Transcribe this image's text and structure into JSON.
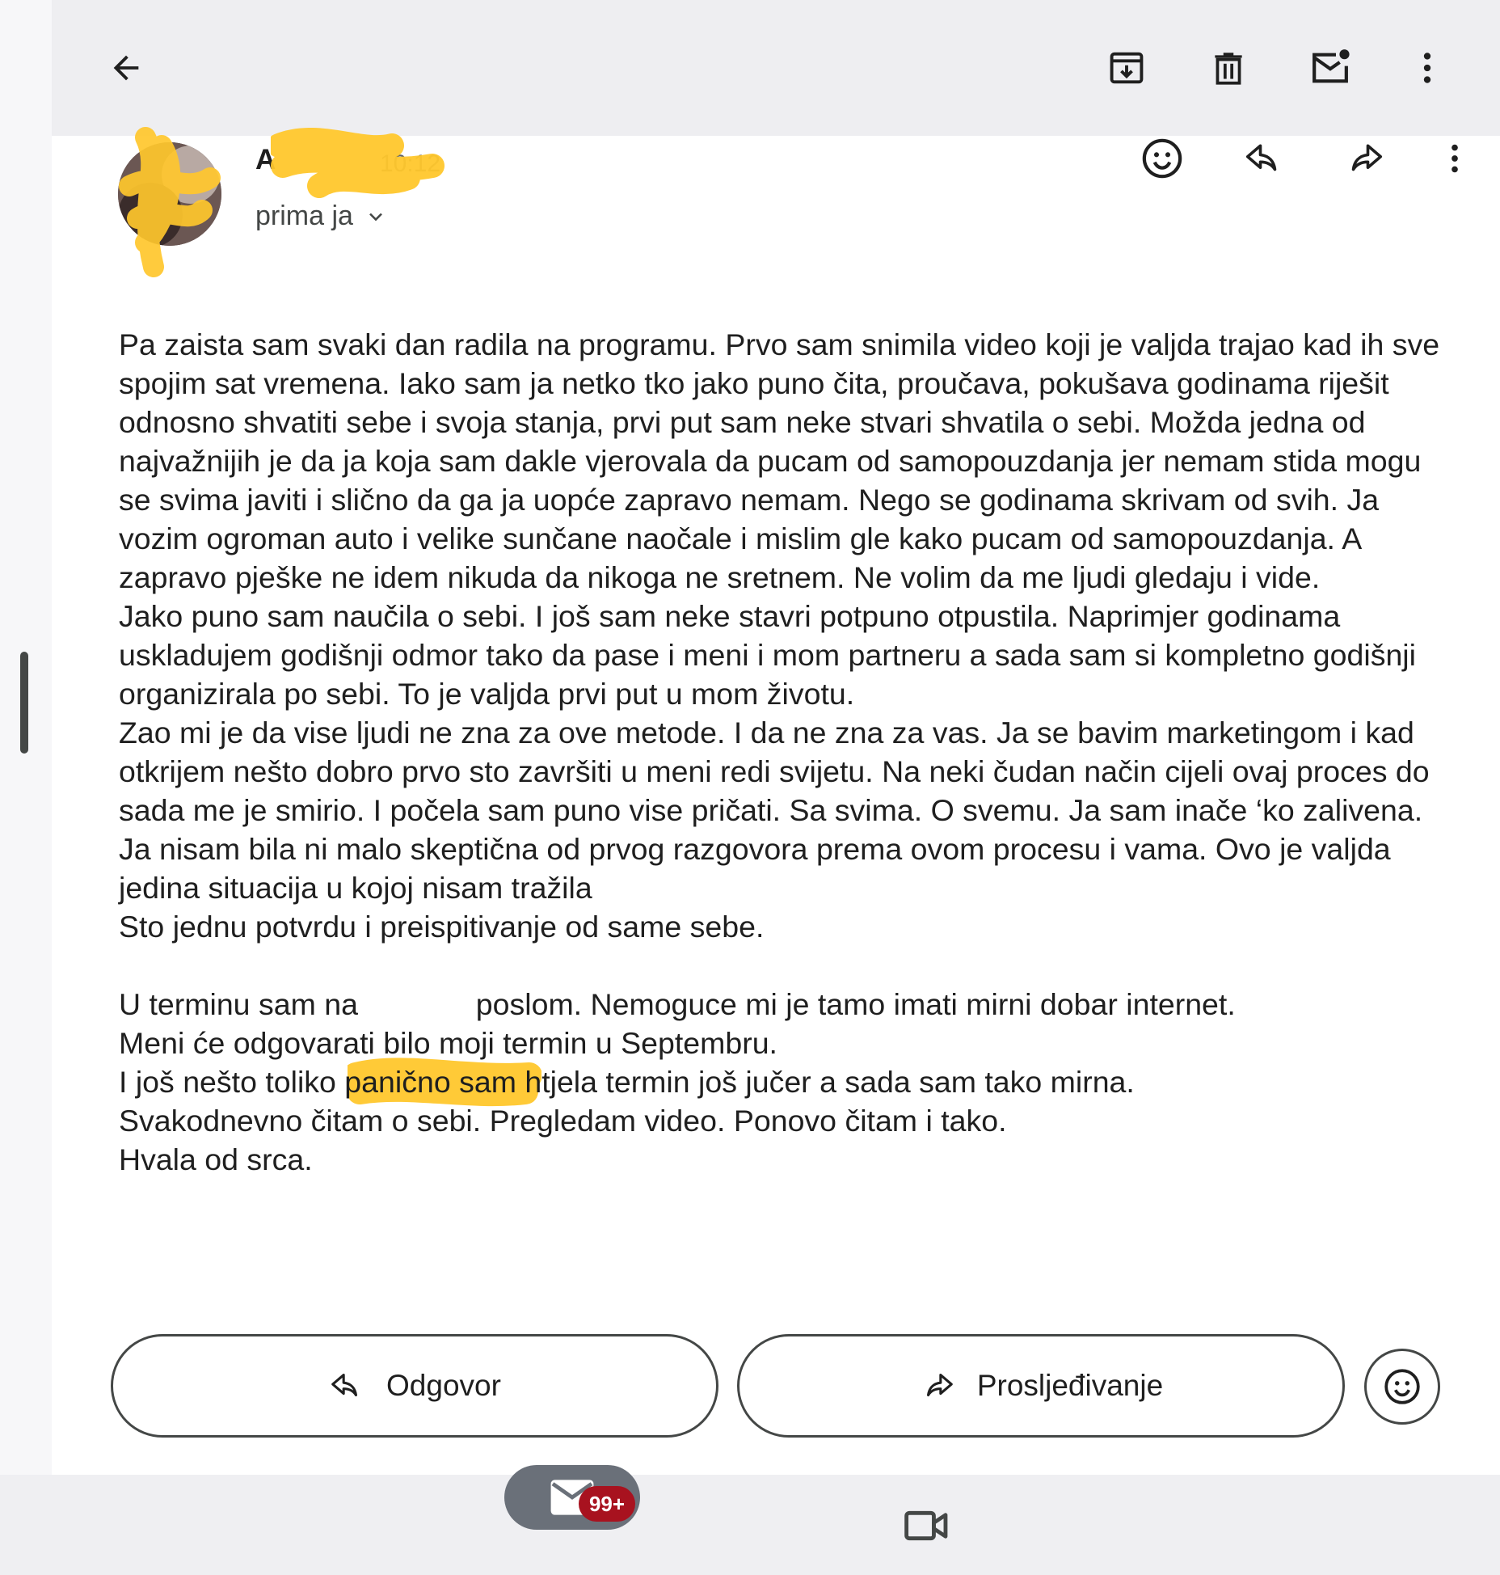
{
  "colors": {
    "accent": "#1f1f1f",
    "badge": "#a8121f",
    "redaction": "#ffc72c",
    "topbar": "#eeeef1"
  },
  "toolbar": {
    "back_icon": "arrow-back-icon",
    "archive_icon": "archive-icon",
    "delete_icon": "delete-icon",
    "mark_unread_icon": "mark-unread-icon",
    "more_icon": "more-vert-icon"
  },
  "message": {
    "sender_initial": "A",
    "time": "10:12",
    "recipients": "prima ja",
    "header_actions": [
      "emoji-icon",
      "reply-icon",
      "forward-icon",
      "more-vert-icon"
    ],
    "paragraphs": [
      "Pa zaista sam svaki dan radila na programu. Prvo sam snimila video koji je valjda trajao kad ih sve spojim sat vremena. Iako sam ja netko tko jako puno čita, proučava, pokušava godinama riješit odnosno shvatiti sebe i svoja stanja, prvi put sam neke stvari shvatila o sebi. Možda jedna od najvažnijih je da ja koja sam dakle vjerovala da pucam od samopouzdanja jer nemam stida mogu se svima javiti i slično da ga ja uopće zapravo nemam. Nego se godinama skrivam od svih. Ja vozim ogroman auto i velike sunčane naočale i mislim gle kako pucam od samopouzdanja. A zapravo pješke ne idem nikuda da nikoga ne sretnem. Ne volim da me ljudi gledaju i vide.",
      "Jako puno sam naučila o sebi. I još sam neke stavri potpuno otpustila. Naprimjer godinama uskladujem godišnji odmor tako da pase i meni i mom partneru a sada sam si kompletno godišnji organizirala po sebi. To je valjda prvi put u mom životu.",
      "Zao mi je da vise ljudi ne zna za ove metode. I da ne zna za vas. Ja se bavim marketingom i kad otkrijem nešto dobro prvo sto završiti u meni redi svijetu. Na neki čudan način cijeli ovaj proces do sada me je smirio. I počela sam puno vise pričati. Sa svima. O svemu. Ja sam inače ‘ko zalivena.",
      "Ja nisam bila ni malo skeptična od prvog razgovora prema ovom procesu i vama. Ovo je valjda jedina situacija u kojoj nisam tražila",
      "Sto jednu potvrdu i preispitivanje od same sebe.",
      "",
      "U terminu sam na              poslom. Nemoguce mi je tamo imati mirni dobar internet.",
      "Meni će odgovarati bilo moji termin u Septembru.",
      "I još nešto toliko panično sam htjela termin još jučer a sada sam tako mirna.",
      "Svakodnevno čitam o sebi. Pregledam video. Ponovo čitam i tako.",
      "Hvala od srca."
    ]
  },
  "actions": {
    "reply_label": "Odgovor",
    "forward_label": "Proslјeđivanje",
    "emoji_icon": "emoji-icon"
  },
  "bottom_nav": {
    "mail_badge": "99+",
    "mail_icon": "mail-icon",
    "meet_icon": "video-camera-icon"
  }
}
